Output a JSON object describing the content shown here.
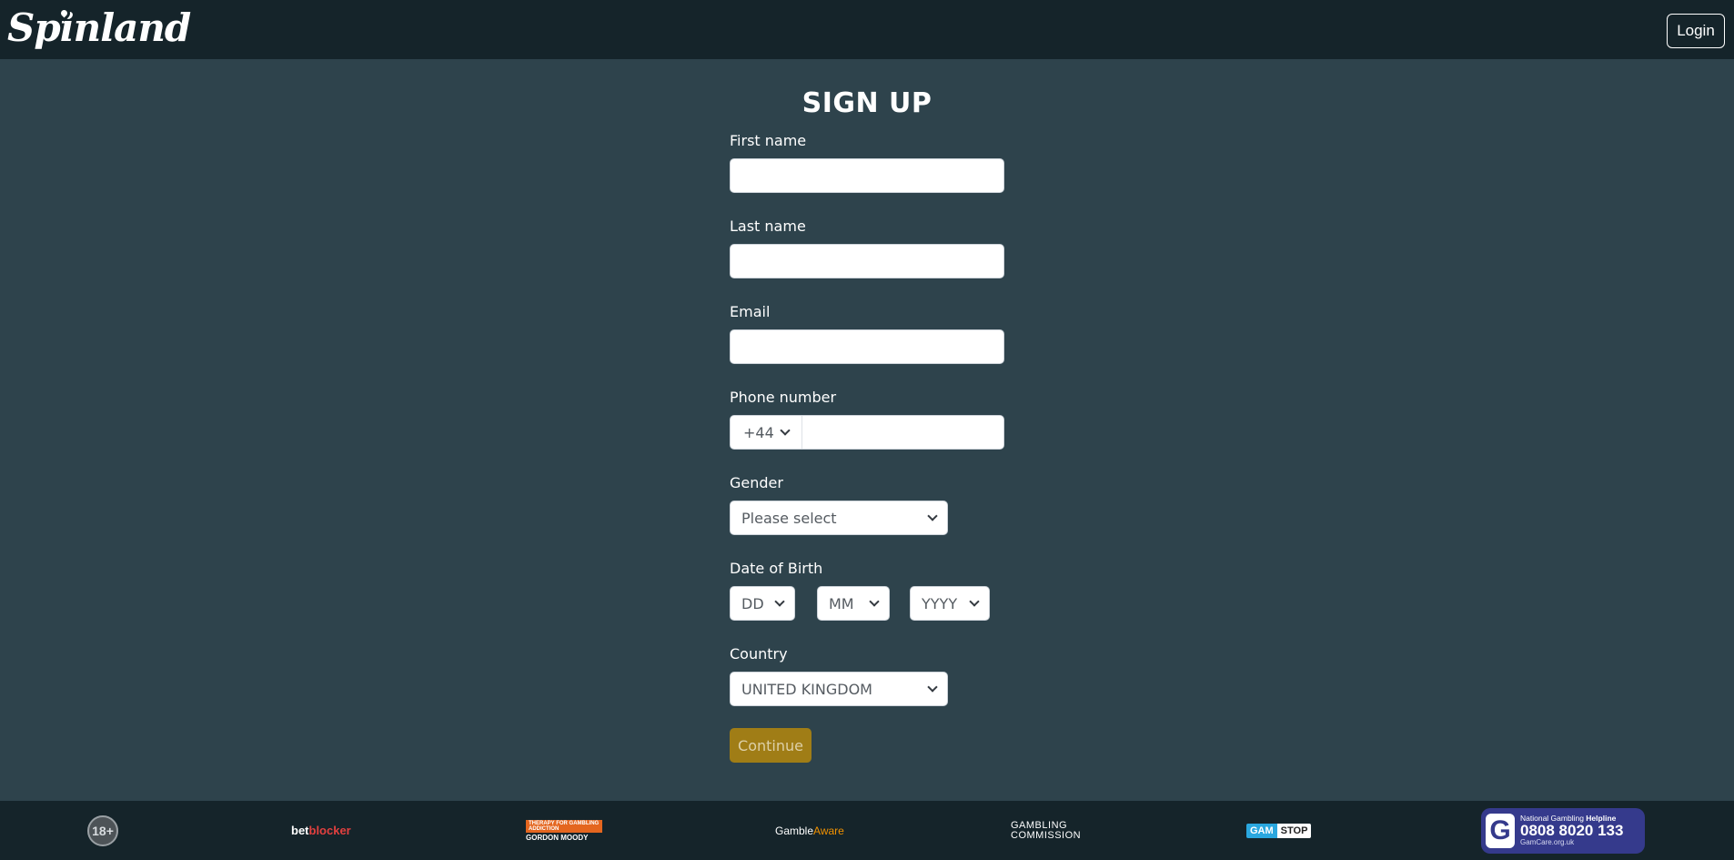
{
  "header": {
    "logo_text": "Spinland",
    "login_label": "Login"
  },
  "form": {
    "title": "SIGN UP",
    "first_name": {
      "label": "First name",
      "value": "",
      "placeholder": ""
    },
    "last_name": {
      "label": "Last name",
      "value": "",
      "placeholder": ""
    },
    "email": {
      "label": "Email",
      "value": "",
      "placeholder": ""
    },
    "phone": {
      "label": "Phone number",
      "country_code": "+44",
      "value": ""
    },
    "gender": {
      "label": "Gender",
      "selected": "Please select"
    },
    "dob": {
      "label": "Date of Birth",
      "day": "DD",
      "month": "MM",
      "year": "YYYY"
    },
    "country": {
      "label": "Country",
      "selected": "UNITED KINGDOM"
    },
    "continue_label": "Continue"
  },
  "footer": {
    "age": "18+",
    "betblocker_a": "bet",
    "betblocker_b": "blocker",
    "gordon_moody_top": "THERAPY FOR GAMBLING ADDICTION",
    "gordon_moody_bottom": "GORDON MOODY",
    "gambleaware_a": "Gamble",
    "gambleaware_b": "Aware",
    "gambling_commission_1": "GAMBLING",
    "gambling_commission_2": "COMMISSION",
    "gamstop_a": "GAM",
    "gamstop_b": "STOP",
    "helpline": {
      "letter": "G",
      "line1_a": "National Gambling ",
      "line1_b": "Helpline",
      "number": "0808 8020 133",
      "site": "GamCare.org.uk"
    }
  },
  "colors": {
    "background": "#2e434c",
    "header_bg": "#15242a",
    "continue_bg": "#a07d16",
    "helpline_bg": "#353a8c"
  }
}
